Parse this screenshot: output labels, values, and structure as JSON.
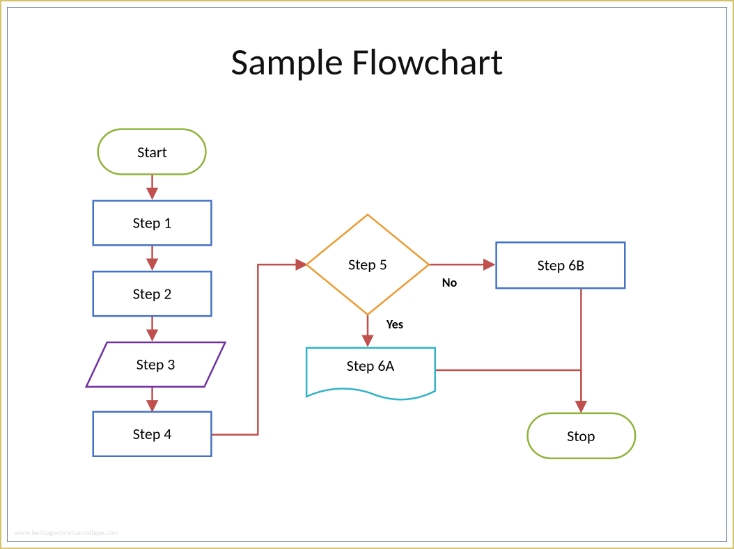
{
  "title": "Sample Flowchart",
  "nodes": {
    "start": {
      "label": "Start"
    },
    "step1": {
      "label": "Step 1"
    },
    "step2": {
      "label": "Step 2"
    },
    "step3": {
      "label": "Step 3"
    },
    "step4": {
      "label": "Step 4"
    },
    "step5": {
      "label": "Step 5"
    },
    "step6a": {
      "label": "Step 6A"
    },
    "step6b": {
      "label": "Step 6B"
    },
    "stop": {
      "label": "Stop"
    }
  },
  "edges": {
    "step5_no": {
      "label": "No"
    },
    "step5_yes": {
      "label": "Yes"
    }
  },
  "colors": {
    "terminator_border": "#8fb33a",
    "process_border": "#4472c4",
    "io_border": "#7030a0",
    "decision_border": "#ed9b33",
    "doc_border": "#31b3c7",
    "connector": "#c0504d",
    "frame": "#d6c26a"
  },
  "chart_data": {
    "type": "flowchart",
    "title": "Sample Flowchart",
    "nodes": [
      {
        "id": "start",
        "type": "terminator",
        "label": "Start"
      },
      {
        "id": "step1",
        "type": "process",
        "label": "Step 1"
      },
      {
        "id": "step2",
        "type": "process",
        "label": "Step 2"
      },
      {
        "id": "step3",
        "type": "io",
        "label": "Step 3"
      },
      {
        "id": "step4",
        "type": "process",
        "label": "Step 4"
      },
      {
        "id": "step5",
        "type": "decision",
        "label": "Step 5"
      },
      {
        "id": "step6a",
        "type": "document",
        "label": "Step 6A"
      },
      {
        "id": "step6b",
        "type": "process",
        "label": "Step 6B"
      },
      {
        "id": "stop",
        "type": "terminator",
        "label": "Stop"
      }
    ],
    "edges": [
      {
        "from": "start",
        "to": "step1"
      },
      {
        "from": "step1",
        "to": "step2"
      },
      {
        "from": "step2",
        "to": "step3"
      },
      {
        "from": "step3",
        "to": "step4"
      },
      {
        "from": "step4",
        "to": "step5"
      },
      {
        "from": "step5",
        "to": "step6a",
        "label": "Yes"
      },
      {
        "from": "step5",
        "to": "step6b",
        "label": "No"
      },
      {
        "from": "step6a",
        "to": "stop"
      },
      {
        "from": "step6b",
        "to": "stop"
      }
    ]
  }
}
